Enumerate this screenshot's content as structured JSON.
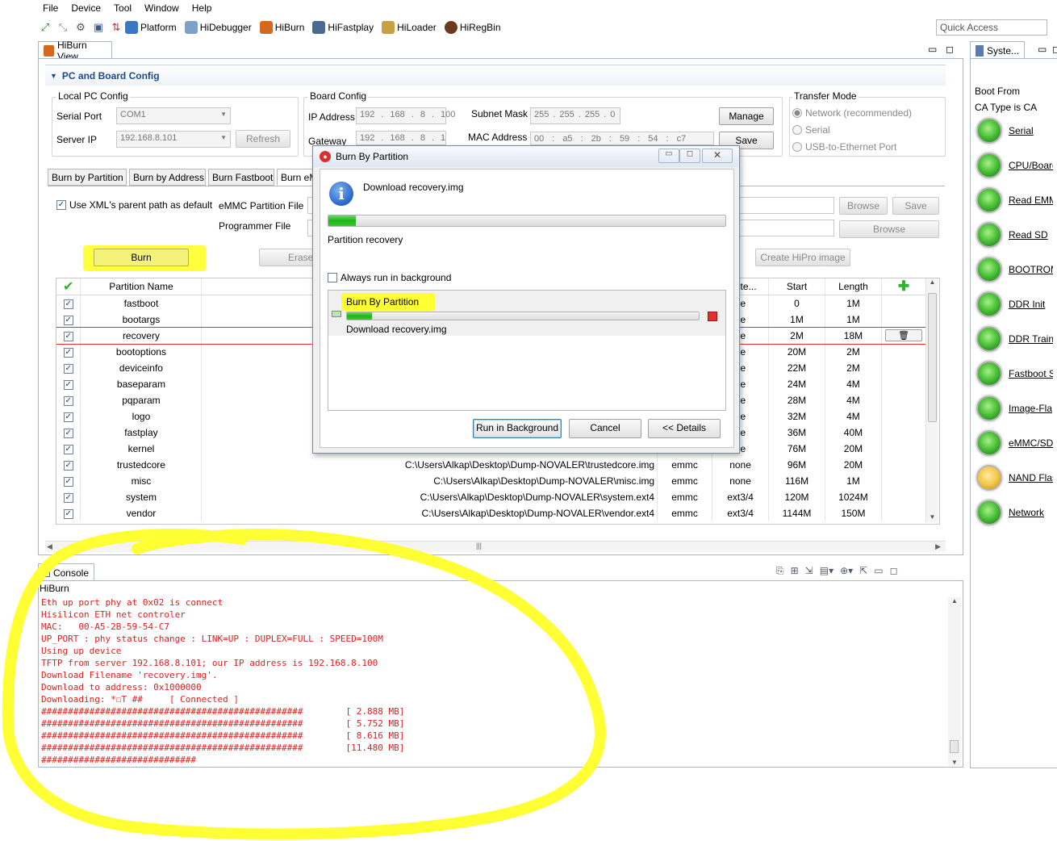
{
  "menu": [
    "File",
    "Device",
    "Tool",
    "Window",
    "Help"
  ],
  "toolbar": {
    "tools": [
      {
        "icon": "platform-icon",
        "label": "Platform"
      },
      {
        "icon": "hidebugger-icon",
        "label": "HiDebugger"
      },
      {
        "icon": "hiburn-icon",
        "label": "HiBurn"
      },
      {
        "icon": "hifastplay-icon",
        "label": "HiFastplay"
      },
      {
        "icon": "hiloader-icon",
        "label": "HiLoader"
      },
      {
        "icon": "hiregbin-icon",
        "label": "HiRegBin"
      }
    ]
  },
  "quick_access": "Quick Access",
  "view": {
    "tab_label": "HiBurn View",
    "section_title": "PC and Board Config",
    "local_pc": {
      "title": "Local PC Config",
      "serial_port_label": "Serial Port",
      "serial_port_value": "COM1",
      "server_ip_label": "Server IP",
      "server_ip_value": "192.168.8.101",
      "refresh_label": "Refresh"
    },
    "board": {
      "title": "Board Config",
      "ip_label": "IP Address",
      "ip": [
        "192",
        "168",
        "8",
        "100"
      ],
      "gateway_label": "Gateway",
      "gateway": [
        "192",
        "168",
        "8",
        "1"
      ],
      "subnet_label": "Subnet Mask",
      "subnet": [
        "255",
        "255",
        "255",
        "0"
      ],
      "mac_label": "MAC Address",
      "mac": [
        "00",
        "a5",
        "2b",
        "59",
        "54",
        "c7"
      ],
      "manage_label": "Manage",
      "save_label": "Save"
    },
    "transfer": {
      "title": "Transfer Mode",
      "options": [
        "Network (recommended)",
        "Serial",
        "USB-to-Ethernet Port"
      ],
      "selected": "Network (recommended)"
    },
    "tabs": [
      "Burn by Partition",
      "Burn by Address",
      "Burn Fastboot",
      "Burn eMMC"
    ],
    "tab_selected_label": "Burn eM",
    "use_xml_label": "Use XML's parent path as default",
    "emmc_partition_file_label": "eMMC Partition File",
    "programmer_file_label": "Programmer File",
    "browse_label": "Browse",
    "save_label": "Save",
    "burn_label": "Burn",
    "erase_label": "Erase",
    "create_hipro_label": "Create HiPro image",
    "table": {
      "headers": {
        "name": "Partition Name",
        "fs": "Syste...",
        "start": "Start",
        "length": "Length"
      },
      "rows": [
        {
          "name": "fastboot",
          "file": "",
          "dev": "",
          "fs": "ne",
          "start": "0",
          "length": "1M"
        },
        {
          "name": "bootargs",
          "file": "",
          "dev": "",
          "fs": "ne",
          "start": "1M",
          "length": "1M"
        },
        {
          "name": "recovery",
          "file": "",
          "dev": "",
          "fs": "ne",
          "start": "2M",
          "length": "18M"
        },
        {
          "name": "bootoptions",
          "file": "",
          "dev": "",
          "fs": "ne",
          "start": "20M",
          "length": "2M"
        },
        {
          "name": "deviceinfo",
          "file": "",
          "dev": "",
          "fs": "ne",
          "start": "22M",
          "length": "2M"
        },
        {
          "name": "baseparam",
          "file": "",
          "dev": "",
          "fs": "ne",
          "start": "24M",
          "length": "4M"
        },
        {
          "name": "pqparam",
          "file": "",
          "dev": "",
          "fs": "ne",
          "start": "28M",
          "length": "4M"
        },
        {
          "name": "logo",
          "file": "",
          "dev": "",
          "fs": "ne",
          "start": "32M",
          "length": "4M"
        },
        {
          "name": "fastplay",
          "file": "",
          "dev": "",
          "fs": "ne",
          "start": "36M",
          "length": "40M"
        },
        {
          "name": "kernel",
          "file": "",
          "dev": "",
          "fs": "ne",
          "start": "76M",
          "length": "20M"
        },
        {
          "name": "trustedcore",
          "file": "C:\\Users\\Alkap\\Desktop\\Dump-NOVALER\\trustedcore.img",
          "dev": "emmc",
          "fs": "none",
          "start": "96M",
          "length": "20M"
        },
        {
          "name": "misc",
          "file": "C:\\Users\\Alkap\\Desktop\\Dump-NOVALER\\misc.img",
          "dev": "emmc",
          "fs": "none",
          "start": "116M",
          "length": "1M"
        },
        {
          "name": "system",
          "file": "C:\\Users\\Alkap\\Desktop\\Dump-NOVALER\\system.ext4",
          "dev": "emmc",
          "fs": "ext3/4",
          "start": "120M",
          "length": "1024M"
        },
        {
          "name": "vendor",
          "file": "C:\\Users\\Alkap\\Desktop\\Dump-NOVALER\\vendor.ext4",
          "dev": "emmc",
          "fs": "ext3/4",
          "start": "1144M",
          "length": "150M"
        }
      ],
      "selected_row": "recovery"
    }
  },
  "dialog": {
    "title": "Burn By Partition",
    "message": "Download recovery.img",
    "progress": 0.07,
    "status": "Partition recovery",
    "always_background_label": "Always run in background",
    "job_title": "Burn By Partition",
    "job_progress": 0.07,
    "job_status": "Download recovery.img",
    "run_bg_label": "Run in Background",
    "cancel_label": "Cancel",
    "details_label": "<< Details"
  },
  "console": {
    "tab_label": "Console",
    "source": "HiBurn",
    "lines": [
      "Eth up port phy at 0x02 is connect",
      "Hisilicon ETH net controler",
      "MAC:   00-A5-2B-59-54-C7",
      "UP_PORT : phy status change : LINK=UP : DUPLEX=FULL : SPEED=100M",
      "Using up device",
      "TFTP from server 192.168.8.101; our IP address is 192.168.8.100",
      "Download Filename 'recovery.img'.",
      "Download to address: 0x1000000",
      "Downloading: *☐T ##     [ Connected ]",
      "#################################################        [ 2.888 MB]",
      "#################################################        [ 5.752 MB]",
      "#################################################        [ 8.616 MB]",
      "#################################################        [11.480 MB]",
      "#############################"
    ]
  },
  "system_view": {
    "tab_label": "Syste...",
    "boot_from_label": "Boot From",
    "ca_type_label": "CA Type is  CA",
    "items": [
      {
        "label": "Serial",
        "state": "green"
      },
      {
        "label": "CPU/Board",
        "state": "green"
      },
      {
        "label": "Read EMMC",
        "state": "green"
      },
      {
        "label": "Read SD",
        "state": "green"
      },
      {
        "label": "BOOTROM",
        "state": "green"
      },
      {
        "label": "DDR Init",
        "state": "green"
      },
      {
        "label": "DDR Train",
        "state": "green"
      },
      {
        "label": "Fastboot S",
        "state": "green"
      },
      {
        "label": "Image-Fla",
        "state": "green"
      },
      {
        "label": "eMMC/SD",
        "state": "green"
      },
      {
        "label": "NAND Flas",
        "state": "amber"
      },
      {
        "label": "Network",
        "state": "green"
      }
    ]
  },
  "colors": {
    "highlight": "#ffff33",
    "console_text": "#e02020",
    "selected_row_border": "#e03030"
  }
}
